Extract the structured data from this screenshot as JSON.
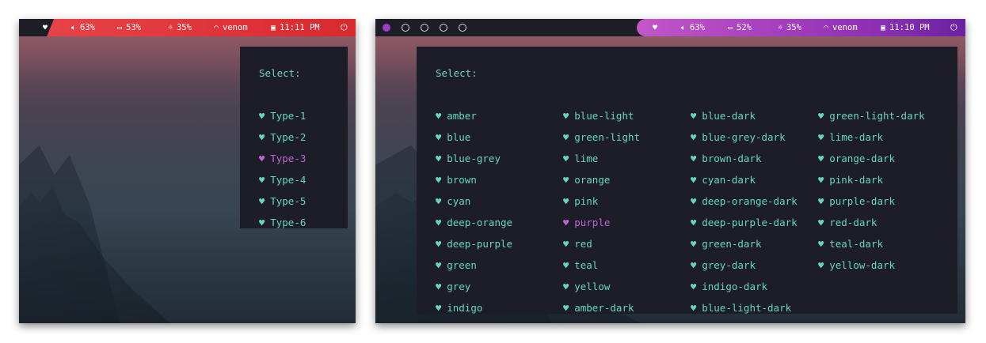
{
  "screen1": {
    "statusbar": {
      "heart_icon": "heart-icon",
      "volume": "63%",
      "battery": "53%",
      "brightness": "35%",
      "wifi": "venom",
      "time": "11:11 PM"
    },
    "menu": {
      "prompt": "Select:",
      "items": [
        {
          "label": "Type-1",
          "selected": false
        },
        {
          "label": "Type-2",
          "selected": false
        },
        {
          "label": "Type-3",
          "selected": true
        },
        {
          "label": "Type-4",
          "selected": false
        },
        {
          "label": "Type-5",
          "selected": false
        },
        {
          "label": "Type-6",
          "selected": false
        }
      ]
    }
  },
  "screen2": {
    "statusbar": {
      "workspaces": [
        "active",
        "empty",
        "empty",
        "empty",
        "empty"
      ],
      "volume": "63%",
      "battery": "52%",
      "brightness": "35%",
      "wifi": "venom",
      "time": "11:10 PM"
    },
    "menu": {
      "prompt": "Select:",
      "columns": [
        [
          "amber",
          "blue",
          "blue-grey",
          "brown",
          "cyan",
          "deep-orange",
          "deep-purple",
          "green",
          "grey",
          "indigo"
        ],
        [
          "blue-light",
          "green-light",
          "lime",
          "orange",
          "pink",
          "purple",
          "red",
          "teal",
          "yellow",
          "amber-dark"
        ],
        [
          "blue-dark",
          "blue-grey-dark",
          "brown-dark",
          "cyan-dark",
          "deep-orange-dark",
          "deep-purple-dark",
          "green-dark",
          "grey-dark",
          "indigo-dark",
          "blue-light-dark"
        ],
        [
          "green-light-dark",
          "lime-dark",
          "orange-dark",
          "pink-dark",
          "purple-dark",
          "red-dark",
          "teal-dark",
          "yellow-dark"
        ]
      ],
      "selected": "purple"
    }
  },
  "colors": {
    "item": "#65d6c0",
    "selected": "#c264d8",
    "menu_bg": "#1c1d27",
    "bar1": "#e33b40",
    "bar2_accent": "#a840bf"
  }
}
